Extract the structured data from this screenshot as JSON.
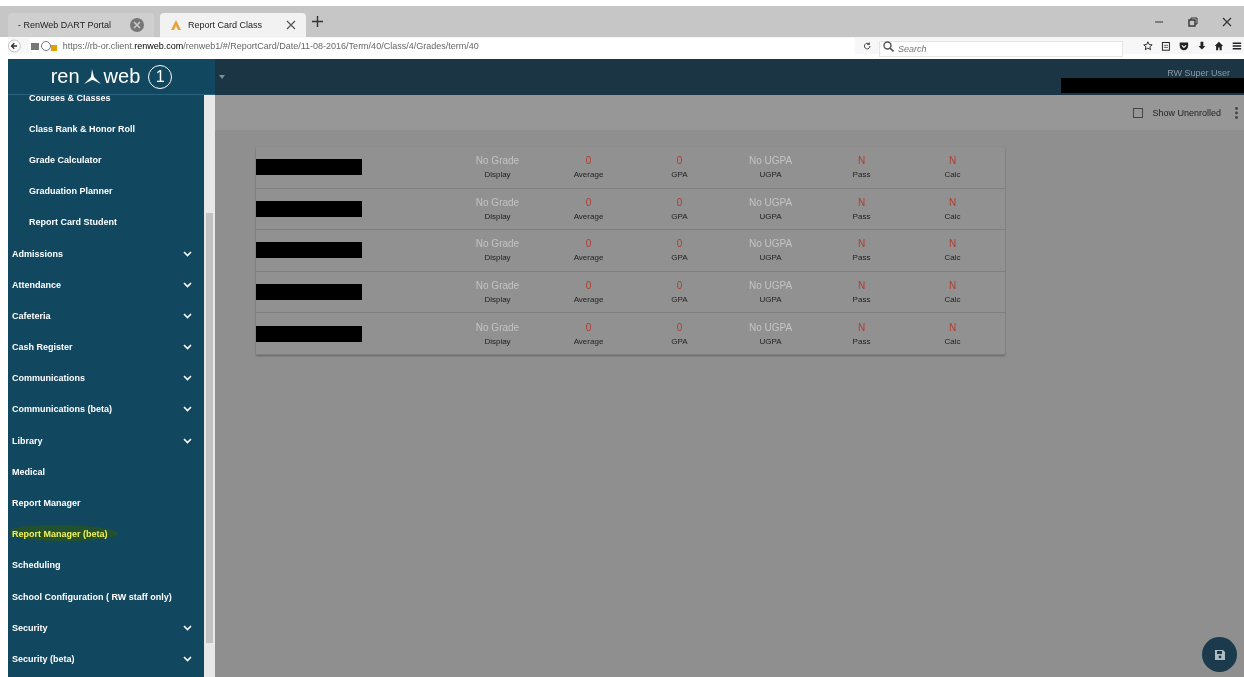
{
  "browser": {
    "tabs": [
      {
        "label": "- RenWeb DART Portal",
        "selected": false
      },
      {
        "label": "Report Card Class",
        "selected": true
      }
    ],
    "url_prefix": "https://rb-or.client.",
    "url_domain": "renweb.com",
    "url_path": "/renweb1/#/ReportCard/Date/11-08-2016/Term/40/Class/4/Grades/term/40",
    "search": {
      "placeholder": "Search"
    }
  },
  "header": {
    "logo_left": "ren",
    "logo_right": "web",
    "logo_number": "1",
    "user": "RW Super User"
  },
  "sidebar": {
    "items": [
      {
        "label": "Courses & Classes",
        "kind": "sub",
        "expandable": false,
        "selected": false
      },
      {
        "label": "Class Rank & Honor Roll",
        "kind": "sub",
        "expandable": false,
        "selected": false
      },
      {
        "label": "Grade Calculator",
        "kind": "sub",
        "expandable": false,
        "selected": false
      },
      {
        "label": "Graduation Planner",
        "kind": "sub",
        "expandable": false,
        "selected": false
      },
      {
        "label": "Report Card Student",
        "kind": "sub",
        "expandable": false,
        "selected": false
      },
      {
        "label": "Admissions",
        "kind": "top",
        "expandable": true,
        "selected": false
      },
      {
        "label": "Attendance",
        "kind": "top",
        "expandable": true,
        "selected": false
      },
      {
        "label": "Cafeteria",
        "kind": "top",
        "expandable": true,
        "selected": false
      },
      {
        "label": "Cash Register",
        "kind": "top",
        "expandable": true,
        "selected": false
      },
      {
        "label": "Communications",
        "kind": "top",
        "expandable": true,
        "selected": false
      },
      {
        "label": "Communications (beta)",
        "kind": "top",
        "expandable": true,
        "selected": false
      },
      {
        "label": "Library",
        "kind": "top",
        "expandable": true,
        "selected": false
      },
      {
        "label": "Medical",
        "kind": "top",
        "expandable": false,
        "selected": false
      },
      {
        "label": "Report Manager",
        "kind": "top",
        "expandable": false,
        "selected": false
      },
      {
        "label": "Report Manager (beta)",
        "kind": "top",
        "expandable": false,
        "selected": true
      },
      {
        "label": "Scheduling",
        "kind": "top",
        "expandable": false,
        "selected": false
      },
      {
        "label": "School Configuration ( RW staff only)",
        "kind": "top",
        "expandable": false,
        "selected": false
      },
      {
        "label": "Security",
        "kind": "top",
        "expandable": true,
        "selected": false
      },
      {
        "label": "Security (beta)",
        "kind": "top",
        "expandable": true,
        "selected": false
      }
    ]
  },
  "toolbar": {
    "show_unenrolled": {
      "label": "Show Unenrolled",
      "checked": false
    }
  },
  "grades": {
    "rows": [
      {
        "cells": [
          {
            "value": "No Grade",
            "label": "Display",
            "empty": true
          },
          {
            "value": "0",
            "label": "Average",
            "empty": false
          },
          {
            "value": "0",
            "label": "GPA",
            "empty": false
          },
          {
            "value": "No UGPA",
            "label": "UGPA",
            "empty": true
          },
          {
            "value": "N",
            "label": "Pass",
            "empty": false
          },
          {
            "value": "N",
            "label": "Calc",
            "empty": false
          }
        ]
      },
      {
        "cells": [
          {
            "value": "No Grade",
            "label": "Display",
            "empty": true
          },
          {
            "value": "0",
            "label": "Average",
            "empty": false
          },
          {
            "value": "0",
            "label": "GPA",
            "empty": false
          },
          {
            "value": "No UGPA",
            "label": "UGPA",
            "empty": true
          },
          {
            "value": "N",
            "label": "Pass",
            "empty": false
          },
          {
            "value": "N",
            "label": "Calc",
            "empty": false
          }
        ]
      },
      {
        "cells": [
          {
            "value": "No Grade",
            "label": "Display",
            "empty": true
          },
          {
            "value": "0",
            "label": "Average",
            "empty": false
          },
          {
            "value": "0",
            "label": "GPA",
            "empty": false
          },
          {
            "value": "No UGPA",
            "label": "UGPA",
            "empty": true
          },
          {
            "value": "N",
            "label": "Pass",
            "empty": false
          },
          {
            "value": "N",
            "label": "Calc",
            "empty": false
          }
        ]
      },
      {
        "cells": [
          {
            "value": "No Grade",
            "label": "Display",
            "empty": true
          },
          {
            "value": "0",
            "label": "Average",
            "empty": false
          },
          {
            "value": "0",
            "label": "GPA",
            "empty": false
          },
          {
            "value": "No UGPA",
            "label": "UGPA",
            "empty": true
          },
          {
            "value": "N",
            "label": "Pass",
            "empty": false
          },
          {
            "value": "N",
            "label": "Calc",
            "empty": false
          }
        ]
      },
      {
        "cells": [
          {
            "value": "No Grade",
            "label": "Display",
            "empty": true
          },
          {
            "value": "0",
            "label": "Average",
            "empty": false
          },
          {
            "value": "0",
            "label": "GPA",
            "empty": false
          },
          {
            "value": "No UGPA",
            "label": "UGPA",
            "empty": true
          },
          {
            "value": "N",
            "label": "Pass",
            "empty": false
          },
          {
            "value": "N",
            "label": "Calc",
            "empty": false
          }
        ]
      }
    ]
  }
}
